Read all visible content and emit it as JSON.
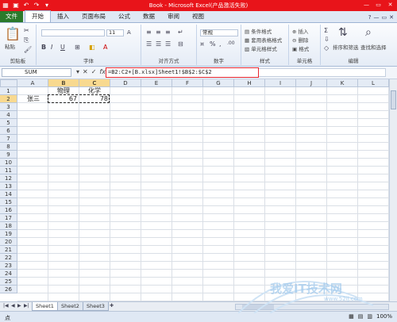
{
  "window": {
    "title": "Book - Microsoft Excel(产品激活失败)",
    "qat_icons": [
      "excel-icon",
      "save-icon",
      "undo-icon",
      "redo-icon",
      "customize-icon"
    ]
  },
  "tabs": [
    {
      "label": "文件"
    },
    {
      "label": "开始"
    },
    {
      "label": "插入"
    },
    {
      "label": "页面布局"
    },
    {
      "label": "公式"
    },
    {
      "label": "数据"
    },
    {
      "label": "审阅"
    },
    {
      "label": "视图"
    }
  ],
  "ribbon": {
    "clipboard": {
      "paste": "粘贴",
      "label": "剪贴板"
    },
    "font": {
      "size": "11",
      "label": "字体"
    },
    "alignment": {
      "label": "对齐方式"
    },
    "number": {
      "format": "常规",
      "label": "数字"
    },
    "styles": {
      "conditional": "条件格式",
      "table": "套用表格格式",
      "cell": "单元格样式",
      "label": "样式"
    },
    "cells": {
      "insert": "插入",
      "delete": "删除",
      "format": "格式",
      "label": "单元格"
    },
    "editing": {
      "sort": "排序和筛选",
      "find": "查找和选择",
      "label": "编辑"
    }
  },
  "formula_bar": {
    "name_box": "SUM",
    "formula": "=B2:C2+[B.xlsx]Sheet1!$B$2:$C$2"
  },
  "grid": {
    "columns": [
      "A",
      "B",
      "C",
      "D",
      "E",
      "F",
      "G",
      "H",
      "I",
      "J",
      "K",
      "L"
    ],
    "rows": [
      "1",
      "2",
      "3",
      "4",
      "5",
      "6",
      "7",
      "8",
      "9",
      "10",
      "11",
      "12",
      "13",
      "14",
      "15",
      "16",
      "17",
      "18",
      "19",
      "20",
      "21",
      "22",
      "23",
      "24",
      "25",
      "26"
    ],
    "cells": {
      "B1": "物理",
      "C1": "化学",
      "A2": "张三",
      "B2": "67",
      "C2": "78"
    }
  },
  "sheets": [
    "Sheet1",
    "Sheet2",
    "Sheet3"
  ],
  "status": {
    "mode": "点",
    "zoom": "100%"
  },
  "watermark": {
    "text": "我爱IT技术网",
    "url": "www.52ij.com"
  },
  "colors": {
    "titlebar": "#e8141a",
    "file_tab": "#2b7a2b",
    "formula_highlight": "#e8262e"
  }
}
